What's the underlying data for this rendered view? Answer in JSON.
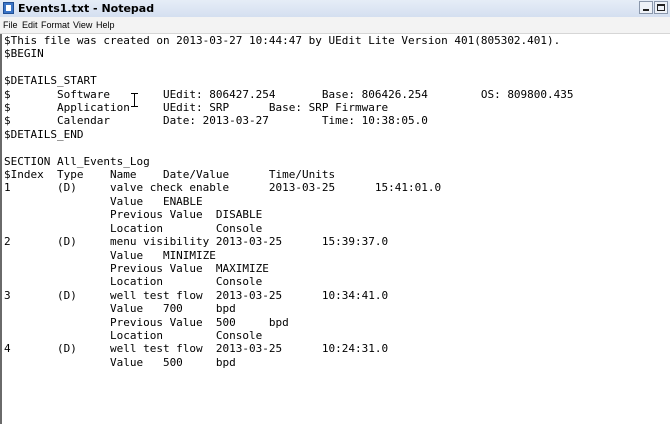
{
  "window": {
    "title": "Events1.txt - Notepad"
  },
  "menu": {
    "items": [
      "File",
      "Edit",
      "Format",
      "View",
      "Help"
    ]
  },
  "document": {
    "lines": [
      "$This file was created on 2013-03-27 10:44:47 by UEdit Lite Version 401(805302.401).",
      "$BEGIN",
      "",
      "$DETAILS_START",
      "$       Software        UEdit: 806427.254       Base: 806426.254        OS: 809800.435",
      "$       Application     UEdit: SRP      Base: SRP Firmware",
      "$       Calendar        Date: 2013-03-27        Time: 10:38:05.0",
      "$DETAILS_END",
      "",
      "SECTION All_Events_Log",
      "$Index  Type    Name    Date/Value      Time/Units",
      "1       (D)     valve check enable      2013-03-25      15:41:01.0",
      "                Value   ENABLE",
      "                Previous Value  DISABLE",
      "                Location        Console",
      "2       (D)     menu visibility 2013-03-25      15:39:37.0",
      "                Value   MINIMIZE",
      "                Previous Value  MAXIMIZE",
      "                Location        Console",
      "3       (D)     well test flow  2013-03-25      10:34:41.0",
      "                Value   700     bpd",
      "                Previous Value  500     bpd",
      "                Location        Console",
      "4       (D)     well test flow  2013-03-25      10:24:31.0",
      "                Value   500     bpd"
    ]
  }
}
